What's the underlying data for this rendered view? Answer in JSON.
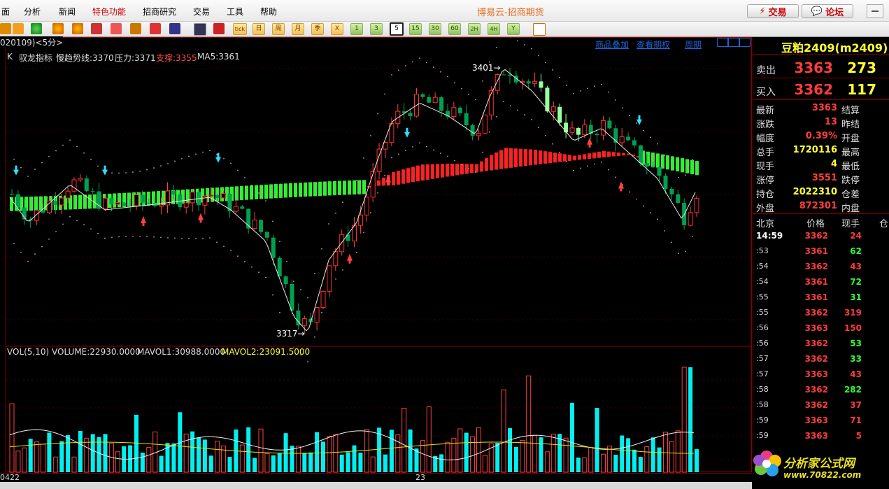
{
  "menu": {
    "items": [
      "面",
      "分析",
      "新闻",
      "特色功能",
      "招商研究",
      "交易",
      "工具",
      "帮助"
    ],
    "active_index": 3
  },
  "app_title": "博易云-招商期货",
  "top_buttons": {
    "trade": "交易",
    "forum": "论坛"
  },
  "toolbar": {
    "period_buttons": [
      "日",
      "周",
      "月",
      "季",
      "X",
      "1",
      "3",
      "5",
      "15",
      "30",
      "60",
      "2H",
      "4H",
      "Y"
    ],
    "selected_period": "5",
    "tick_label": "tick"
  },
  "chart": {
    "contract_tag": "020109)<5分>",
    "links": [
      "商品叠加",
      "查看期权",
      "周期"
    ],
    "indicator": {
      "k_label": "K",
      "name": "驭龙指标",
      "slow_trend_label": "慢趋势线:3370",
      "resistance_label": "压力:3371",
      "support_label": "支撑:3355",
      "ma5_label": "MA5:3361"
    },
    "high_marker": "3401→",
    "low_marker": "3317→",
    "volume_header": {
      "vol_label": "VOL(5,10)",
      "volume": "VOLUME:22930.0000",
      "mavol1": "MAVOL1:30988.0000",
      "mavol2": "MAVOL2:23091.5000"
    },
    "date_labels": [
      "0422",
      "23"
    ],
    "colors": {
      "up": "#ff3232",
      "down": "#00e0e0",
      "bg": "#000000",
      "grid": "#8b0000"
    }
  },
  "chart_data": {
    "type": "candlestick",
    "timeframe": "5分",
    "price_high_marker": 3401,
    "price_low_marker": 3317,
    "last_ma5": 3361,
    "slow_trend": 3370,
    "resistance": 3371,
    "support": 3355,
    "last_volume": 22930,
    "mavol1": 30988,
    "mavol2": 23091.5
  },
  "quote": {
    "symbol": "豆粕2409(m2409)",
    "ask_label": "卖出",
    "ask_price": "3363",
    "ask_volume": "273",
    "bid_label": "买入",
    "bid_price": "3362",
    "bid_volume": "117",
    "fields_left": [
      {
        "label": "最新",
        "value": "3363",
        "color": "#ff3c3c"
      },
      {
        "label": "涨跌",
        "value": "13",
        "color": "#ff3c3c"
      },
      {
        "label": "幅度",
        "value": "0.39%",
        "color": "#ff3c3c"
      },
      {
        "label": "总手",
        "value": "1720116",
        "color": "#ffff33"
      },
      {
        "label": "现手",
        "value": "4",
        "color": "#ffff33"
      },
      {
        "label": "涨停",
        "value": "3551",
        "color": "#ff3c3c"
      },
      {
        "label": "持仓",
        "value": "2022310",
        "color": "#ffff33"
      },
      {
        "label": "外盘",
        "value": "872301",
        "color": "#ff3c3c"
      }
    ],
    "fields_right": [
      "结算",
      "昨结",
      "开盘",
      "最高",
      "最低",
      "跌停",
      "仓差",
      "内盘"
    ],
    "ticks_header": {
      "location": "北京",
      "price": "价格",
      "volume": "现手",
      "extra": "仓"
    },
    "ticks": [
      {
        "time": "14:59",
        "price": "3362",
        "volume": "24",
        "vcolor": "#ff3c3c"
      },
      {
        "time": ":53",
        "price": "3361",
        "volume": "62",
        "vcolor": "#33ff33"
      },
      {
        "time": ":54",
        "price": "3362",
        "volume": "43",
        "vcolor": "#ff3c3c"
      },
      {
        "time": ":54",
        "price": "3361",
        "volume": "72",
        "vcolor": "#33ff33"
      },
      {
        "time": ":55",
        "price": "3361",
        "volume": "31",
        "vcolor": "#33ff33"
      },
      {
        "time": ":55",
        "price": "3362",
        "volume": "319",
        "vcolor": "#ff3c3c"
      },
      {
        "time": ":56",
        "price": "3363",
        "volume": "150",
        "vcolor": "#ff3c3c"
      },
      {
        "time": ":56",
        "price": "3362",
        "volume": "53",
        "vcolor": "#33ff33"
      },
      {
        "time": ":57",
        "price": "3362",
        "volume": "33",
        "vcolor": "#33ff33"
      },
      {
        "time": ":57",
        "price": "3363",
        "volume": "43",
        "vcolor": "#ff3c3c"
      },
      {
        "time": ":58",
        "price": "3362",
        "volume": "282",
        "vcolor": "#33ff33"
      },
      {
        "time": ":58",
        "price": "3362",
        "volume": "37",
        "vcolor": "#ff3c3c"
      },
      {
        "time": ":59",
        "price": "3363",
        "volume": "71",
        "vcolor": "#ff3c3c"
      },
      {
        "time": ":59",
        "price": "3363",
        "volume": "5",
        "vcolor": "#ff3c3c"
      }
    ]
  },
  "watermark": {
    "title": "分析家公式网",
    "url": "www.70822.com"
  }
}
